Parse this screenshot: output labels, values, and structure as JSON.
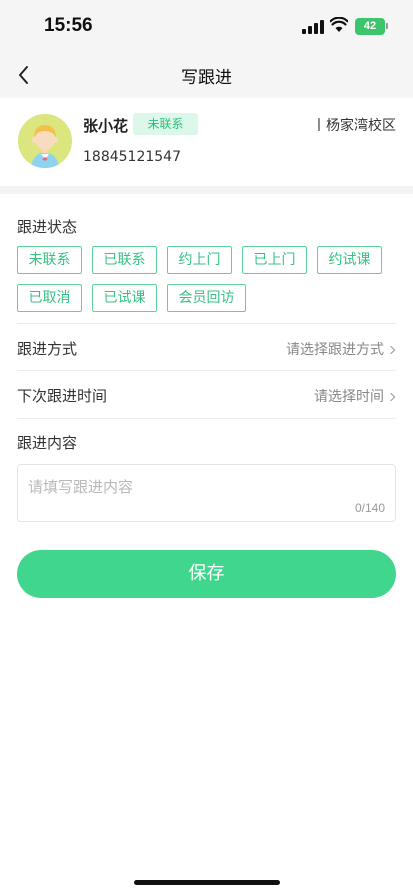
{
  "status_bar": {
    "time": "15:56",
    "battery": "42"
  },
  "nav": {
    "title": "写跟进"
  },
  "profile": {
    "name": "张小花",
    "status_badge": "未联系",
    "phone": "18845121547",
    "campus": "丨杨家湾校区"
  },
  "follow_status": {
    "label": "跟进状态",
    "tags": [
      "未联系",
      "已联系",
      "约上门",
      "已上门",
      "约试课",
      "已取消",
      "已试课",
      "会员回访"
    ]
  },
  "method": {
    "label": "跟进方式",
    "placeholder": "请选择跟进方式"
  },
  "next_time": {
    "label": "下次跟进时间",
    "placeholder": "请选择时间"
  },
  "content": {
    "label": "跟进内容",
    "placeholder": "请填写跟进内容",
    "counter": "0/140"
  },
  "save_label": "保存",
  "colors": {
    "accent": "#40d68d",
    "tag_border": "#5fd49a",
    "badge_bg": "#dcf8ea"
  }
}
